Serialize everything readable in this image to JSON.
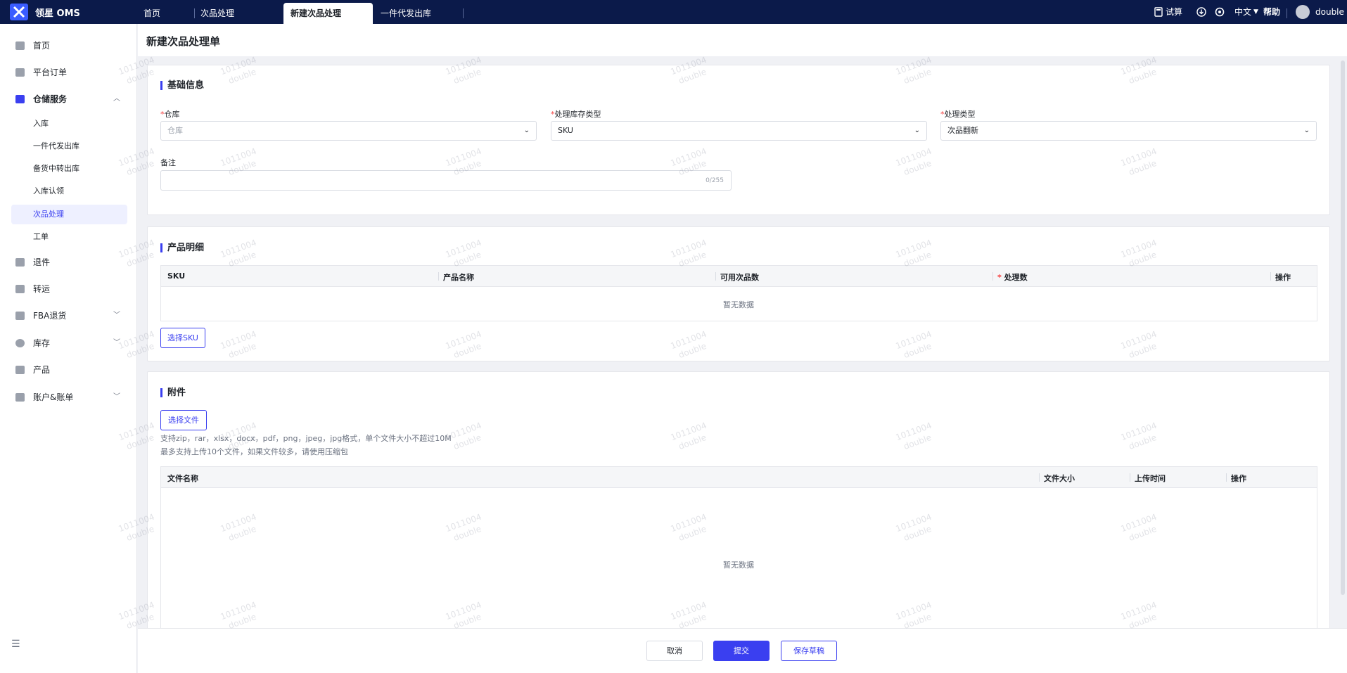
{
  "topbar": {
    "app_name": "领星 OMS",
    "tabs": [
      {
        "label": "首页"
      },
      {
        "label": "次品处理"
      },
      {
        "label": "新建次品处理"
      },
      {
        "label": "一件代发出库"
      }
    ],
    "trial_label": "试算",
    "language": "中文",
    "help_label": "帮助",
    "user_name": "double"
  },
  "sidebar": {
    "items": [
      {
        "label": "首页"
      },
      {
        "label": "平台订单"
      },
      {
        "label": "仓储服务"
      },
      {
        "label": "退件"
      },
      {
        "label": "转运"
      },
      {
        "label": "FBA退货"
      },
      {
        "label": "库存"
      },
      {
        "label": "产品"
      },
      {
        "label": "账户&账单"
      }
    ],
    "sub_items": [
      {
        "label": "入库"
      },
      {
        "label": "一件代发出库"
      },
      {
        "label": "备货中转出库"
      },
      {
        "label": "入库认领"
      },
      {
        "label": "次品处理"
      },
      {
        "label": "工单"
      }
    ]
  },
  "page": {
    "title": "新建次品处理单"
  },
  "basic_info": {
    "title": "基础信息",
    "warehouse_label": "仓库",
    "warehouse_placeholder": "仓库",
    "inventory_type_label": "处理库存类型",
    "inventory_type_value": "SKU",
    "process_type_label": "处理类型",
    "process_type_value": "次品翻新",
    "remark_label": "备注",
    "remark_count": "0/255"
  },
  "products": {
    "title": "产品明细",
    "columns": [
      "SKU",
      "产品名称",
      "可用次品数",
      "处理数",
      "操作"
    ],
    "empty_text": "暂无数据",
    "select_sku_label": "选择SKU"
  },
  "attachments": {
    "title": "附件",
    "select_file_label": "选择文件",
    "hint1": "支持zip，rar，xlsx，docx，pdf，png，jpeg，jpg格式，单个文件大小不超过10M",
    "hint2": "最多支持上传10个文件，如果文件较多，请使用压缩包",
    "columns": [
      "文件名称",
      "文件大小",
      "上传时间",
      "操作"
    ],
    "empty_text": "暂无数据"
  },
  "footer": {
    "cancel_label": "取消",
    "submit_label": "提交",
    "draft_label": "保存草稿"
  },
  "watermark": {
    "line1": "1011004",
    "line2": "double"
  },
  "colors": {
    "topbar": "#0b1a4a",
    "accent": "#3a3ff0",
    "required": "#f53f3f"
  }
}
